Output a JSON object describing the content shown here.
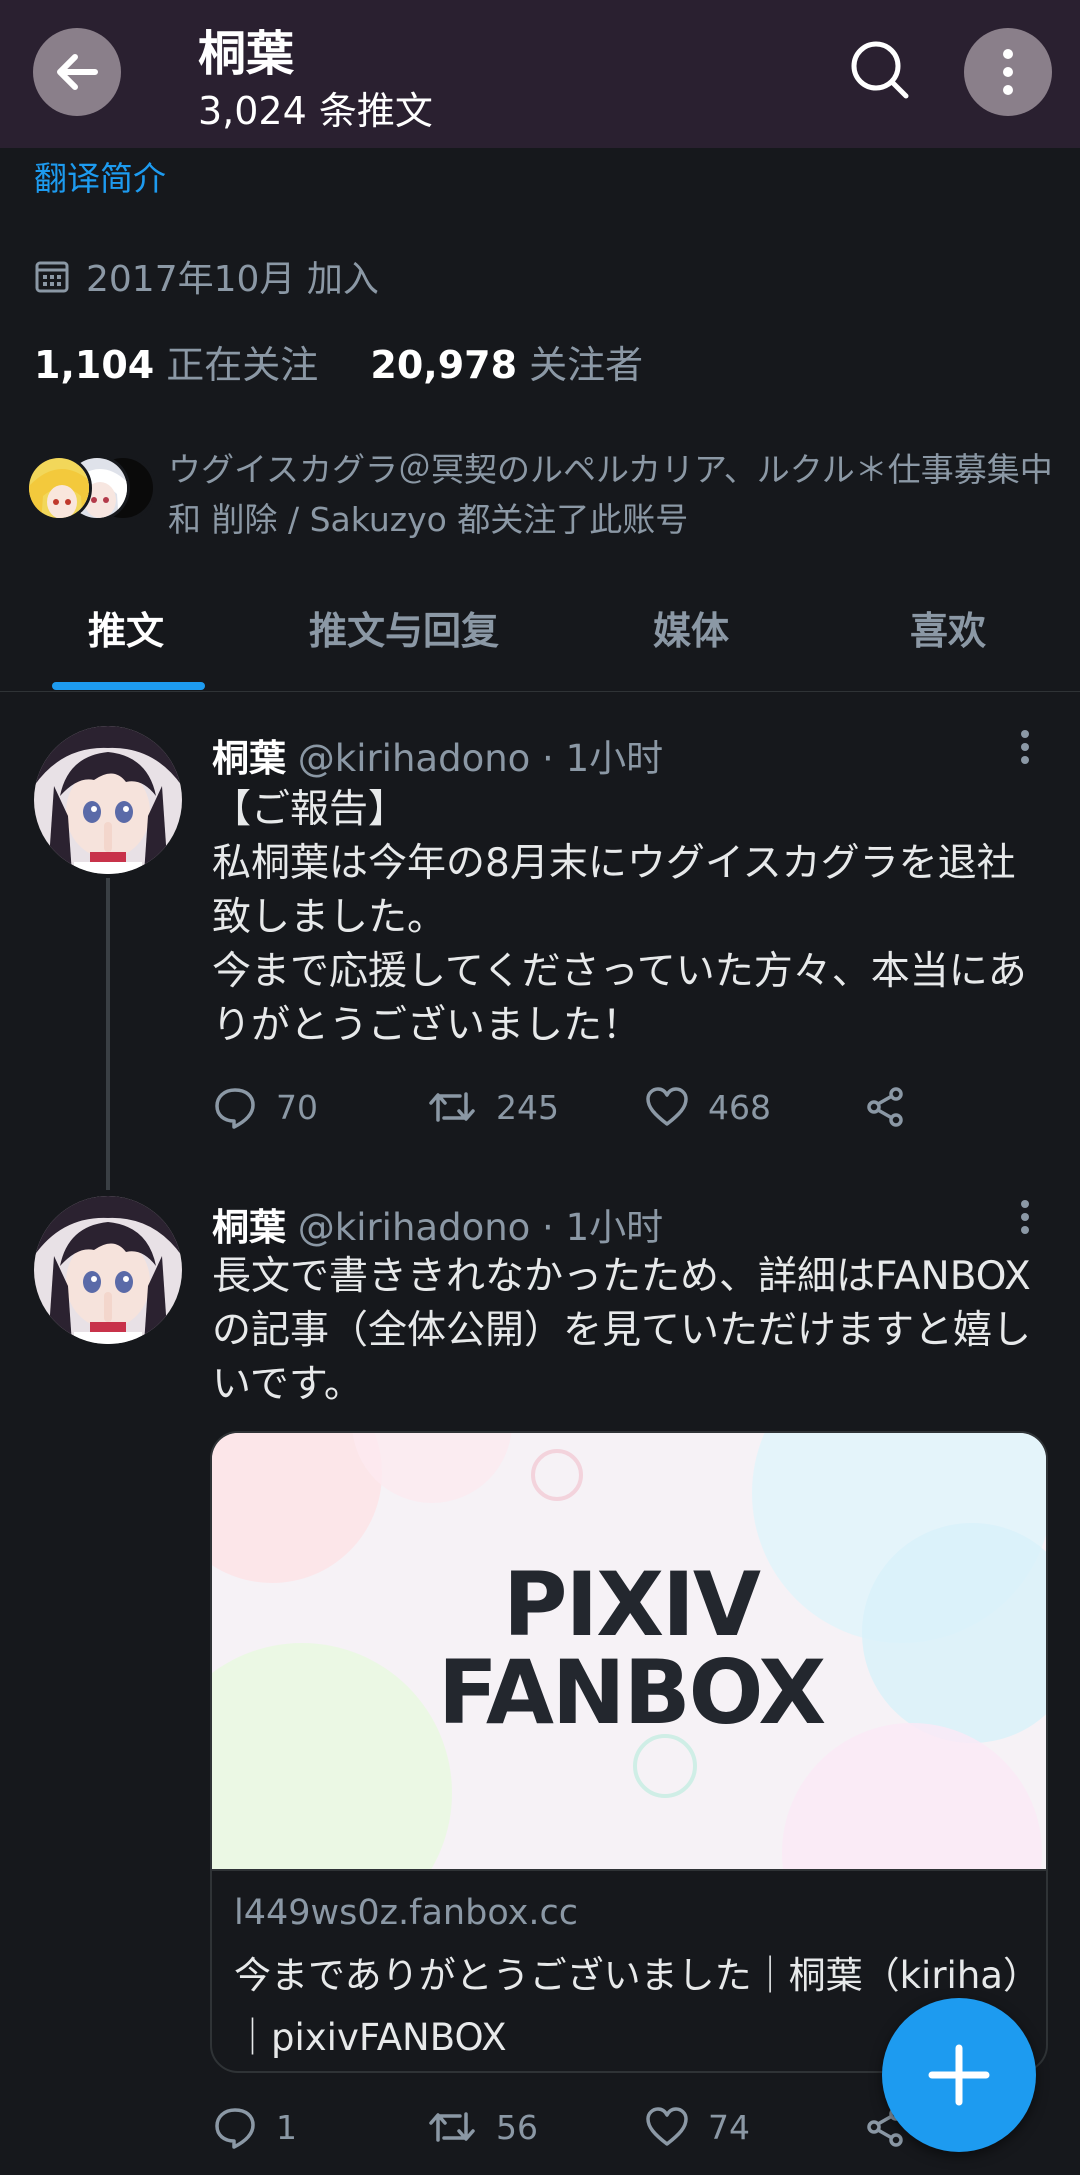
{
  "header": {
    "name": "桐葉",
    "post_count": "3,024 条推文",
    "back_icon": "arrow-left-icon",
    "search_icon": "search-icon",
    "more_icon": "more-vertical-icon",
    "bar_color": "#2a2030"
  },
  "profile": {
    "translate_bio": "翻译简介",
    "joined": "2017年10月 加入",
    "following_count": "1,104",
    "following_label": "正在关注",
    "followers_count": "20,978",
    "followers_label": "关注者",
    "followed_by": "ウグイスカグラ＠冥契のルペルカリア、ルクル＊仕事募集中 和 削除 / Sakuzyo 都关注了此账号"
  },
  "tabs": [
    {
      "label": "推文",
      "active": true
    },
    {
      "label": "推文与回复",
      "active": false
    },
    {
      "label": "媒体",
      "active": false
    },
    {
      "label": "喜欢",
      "active": false
    }
  ],
  "tweets": [
    {
      "name": "桐葉",
      "handle_time": "@kirihadono · 1小时",
      "text": "【ご報告】\n私桐葉は今年の8月末にウグイスカグラを退社致しました。\n今まで応援してくださっていた方々、本当にありがとうございました！",
      "replies": "70",
      "retweets": "245",
      "likes": "468"
    },
    {
      "name": "桐葉",
      "handle_time": "@kirihadono · 1小时",
      "text": "長文で書ききれなかったため、詳細はFANBOXの記事（全体公開）を見ていただけますと嬉しいです。",
      "replies": "1",
      "retweets": "56",
      "likes": "74",
      "card": {
        "logo_line1": "PIXIV",
        "logo_line2": "FANBOX",
        "domain": "l449ws0z.fanbox.cc",
        "title": "今までありがとうございました｜桐葉（kiriha）｜pixivFANBOX"
      }
    }
  ],
  "fab_icon": "plus-icon",
  "accent": "#1d9bf0"
}
